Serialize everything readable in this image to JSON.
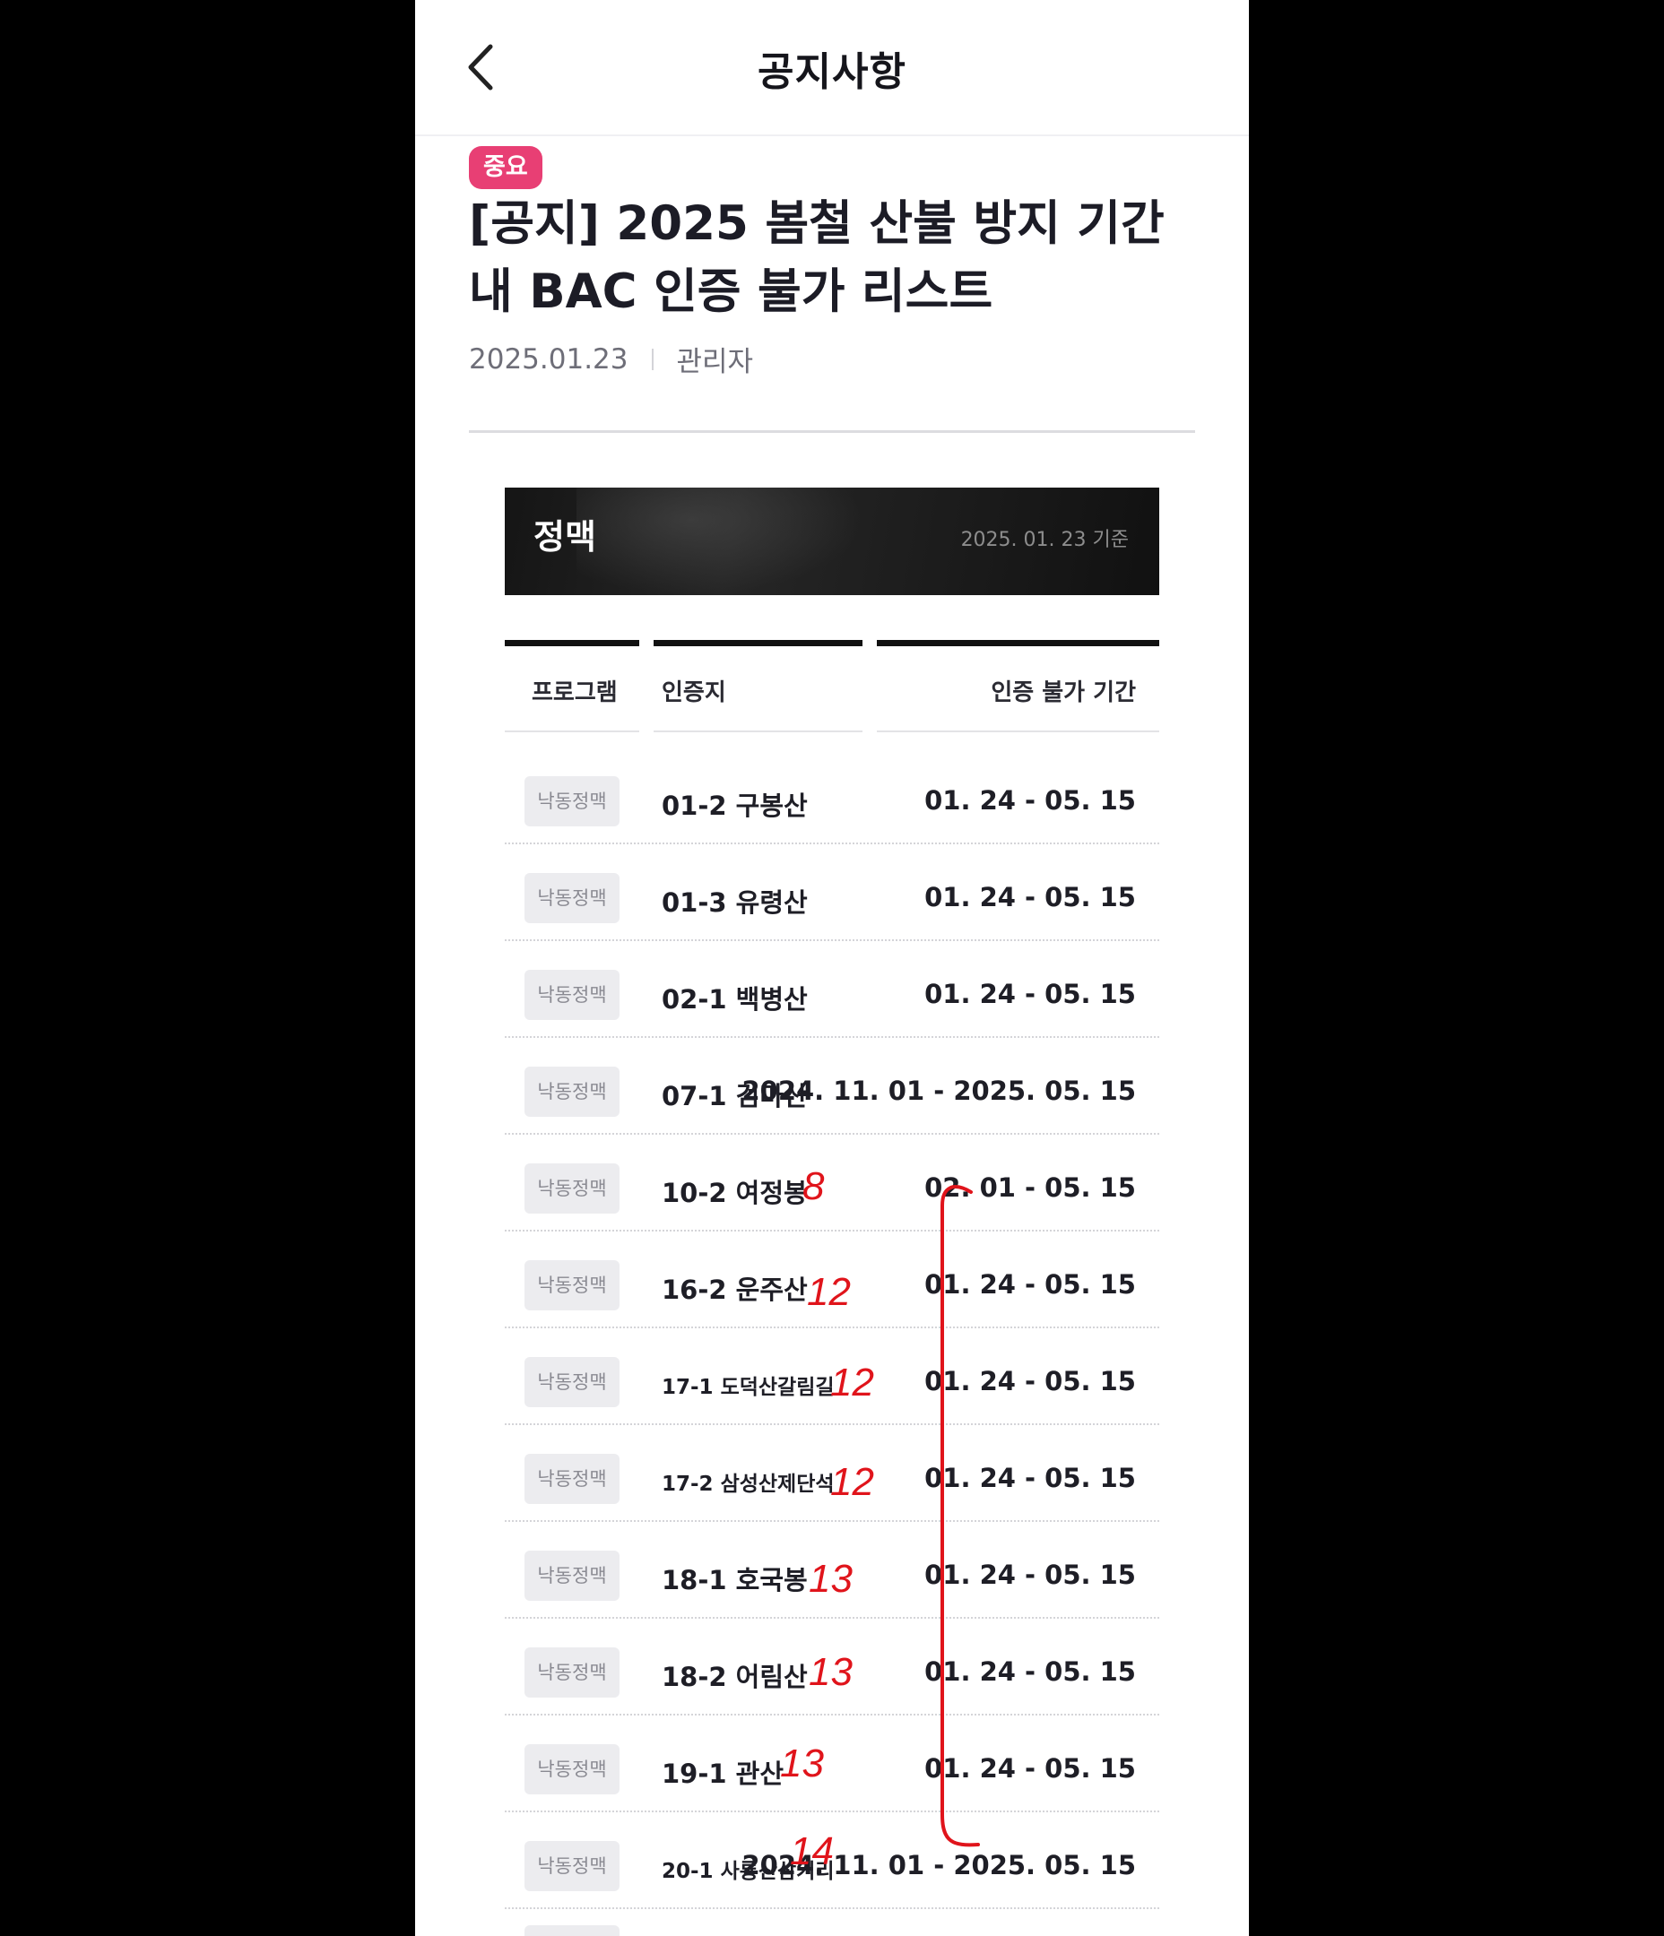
{
  "header": {
    "title": "공지사항"
  },
  "notice": {
    "badge": "중요",
    "title": "[공지] 2025 봄철 산불 방지 기간 내 BAC 인증 불가 리스트",
    "date": "2025.01.23",
    "author": "관리자"
  },
  "banner": {
    "title": "정맥",
    "as_of": "2025. 01. 23 기준"
  },
  "table": {
    "columns": [
      "프로그램",
      "인증지",
      "인증 불가 기간"
    ],
    "rows": [
      {
        "program": "낙동정맥",
        "place": "01-2 구봉산",
        "period": "01. 24 - 05. 15"
      },
      {
        "program": "낙동정맥",
        "place": "01-3 유령산",
        "period": "01. 24 - 05. 15"
      },
      {
        "program": "낙동정맥",
        "place": "02-1 백병산",
        "period": "01. 24 - 05. 15"
      },
      {
        "program": "낙동정맥",
        "place": "07-1 검마산",
        "period": "2024. 11. 01 - 2025. 05. 15"
      },
      {
        "program": "낙동정맥",
        "place": "10-2 여정봉",
        "period": "02. 01 - 05. 15"
      },
      {
        "program": "낙동정맥",
        "place": "16-2 운주산",
        "period": "01. 24 - 05. 15"
      },
      {
        "program": "낙동정맥",
        "place": "17-1 도덕산갈림길",
        "period": "01. 24 - 05. 15"
      },
      {
        "program": "낙동정맥",
        "place": "17-2 삼성산제단석",
        "period": "01. 24 - 05. 15"
      },
      {
        "program": "낙동정맥",
        "place": "18-1 호국봉",
        "period": "01. 24 - 05. 15"
      },
      {
        "program": "낙동정맥",
        "place": "18-2 어림산",
        "period": "01. 24 - 05. 15"
      },
      {
        "program": "낙동정맥",
        "place": "19-1 관산",
        "period": "01. 24 - 05. 15"
      },
      {
        "program": "낙동정맥",
        "place": "20-1 사룡산삼거리",
        "period": "2024. 11. 01 - 2025. 05. 15"
      }
    ]
  },
  "annotations": {
    "color": "#e0141b",
    "numbers": [
      "8",
      "12",
      "12",
      "12",
      "13",
      "13",
      "13",
      "14"
    ]
  },
  "colors": {
    "badge": "#e83f74",
    "banner": "#1b1b1b"
  },
  "icons": {
    "back": "chevron-left-icon"
  }
}
